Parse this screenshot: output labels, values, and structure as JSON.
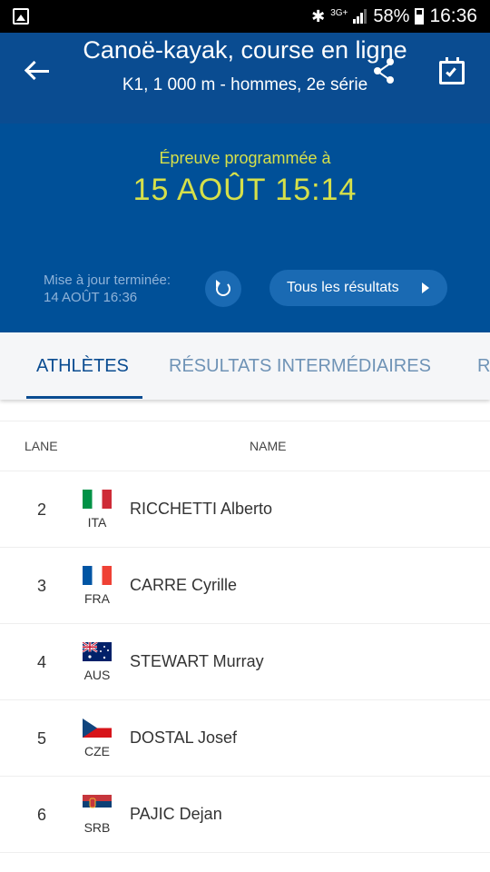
{
  "status_bar": {
    "network": "3G+",
    "battery": "58%",
    "time": "16:36"
  },
  "header": {
    "title": "Canoë-kayak, course en ligne",
    "subtitle": "K1, 1 000 m - hommes, 2e série",
    "scheduled_label": "Épreuve programmée à",
    "scheduled_time": "15 AOÛT 15:14",
    "update_label": "Mise à jour terminée:",
    "update_time": "14 AOÛT 16:36",
    "all_results_label": "Tous les résultats",
    "schedule_color": "#d6e04a"
  },
  "tabs": [
    {
      "label": "ATHLÈTES",
      "active": true
    },
    {
      "label": "RÉSULTATS INTERMÉDIAIRES",
      "active": false
    },
    {
      "label": "R",
      "active": false
    }
  ],
  "table": {
    "columns": {
      "lane": "LANE",
      "name": "NAME"
    },
    "rows": [
      {
        "lane": "2",
        "noc": "ITA",
        "flag": "italy-flag",
        "name": "RICCHETTI Alberto"
      },
      {
        "lane": "3",
        "noc": "FRA",
        "flag": "france-flag",
        "name": "CARRE Cyrille"
      },
      {
        "lane": "4",
        "noc": "AUS",
        "flag": "australia-flag",
        "name": "STEWART Murray"
      },
      {
        "lane": "5",
        "noc": "CZE",
        "flag": "czech-flag",
        "name": "DOSTAL Josef"
      },
      {
        "lane": "6",
        "noc": "SRB",
        "flag": "serbia-flag",
        "name": "PAJIC Dejan"
      }
    ]
  }
}
